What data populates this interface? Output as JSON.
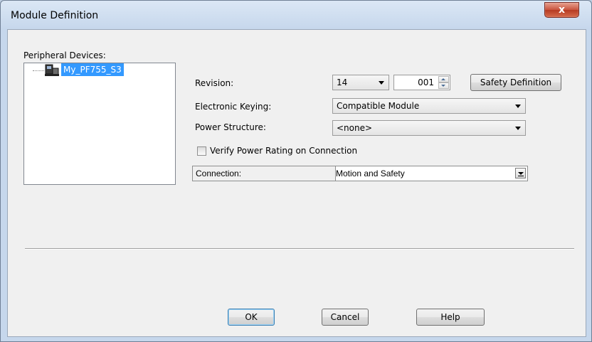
{
  "window": {
    "title": "Module Definition",
    "close_glyph": "x"
  },
  "peripheral": {
    "label": "Peripheral Devices:",
    "tree_item": "My_PF755_S3",
    "tree_icon": "drive-device-icon"
  },
  "revision": {
    "label": "Revision:",
    "major": "14",
    "minor": "001"
  },
  "safety_button": "Safety Definition",
  "keying": {
    "label": "Electronic Keying:",
    "value": "Compatible Module"
  },
  "power_structure": {
    "label": "Power Structure:",
    "value": "<none>"
  },
  "verify": {
    "label": "Verify Power Rating on Connection",
    "checked": false
  },
  "connection": {
    "label": "Connection:",
    "value": "Motion and Safety"
  },
  "buttons": {
    "ok": "OK",
    "cancel": "Cancel",
    "help": "Help"
  },
  "colors": {
    "selection": "#3399ff",
    "close_button": "#c8533d"
  }
}
